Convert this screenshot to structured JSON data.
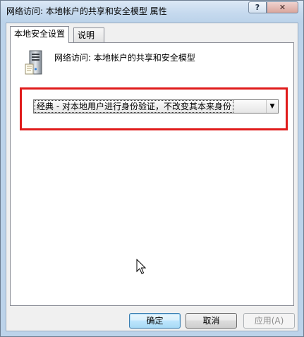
{
  "window": {
    "title": "网络访问: 本地帐户的共享和安全模型 属性",
    "help_label": "?",
    "close_label": "✕"
  },
  "tabs": [
    {
      "label": "本地安全设置",
      "active": true
    },
    {
      "label": "说明",
      "active": false
    }
  ],
  "policy": {
    "icon": "server-computer-icon",
    "title": "网络访问: 本地帐户的共享和安全模型"
  },
  "dropdown": {
    "selected": "经典 - 对本地用户进行身份验证，不改变其本来身份",
    "arrow_label": "▼"
  },
  "highlight": {
    "color": "#e01b1b"
  },
  "buttons": {
    "ok": "确定",
    "cancel": "取消",
    "apply": "应用(A)"
  },
  "colors": {
    "accent_border": "#3c7fb1",
    "highlight_red": "#e01b1b",
    "disabled_text": "#8d8d8d"
  }
}
